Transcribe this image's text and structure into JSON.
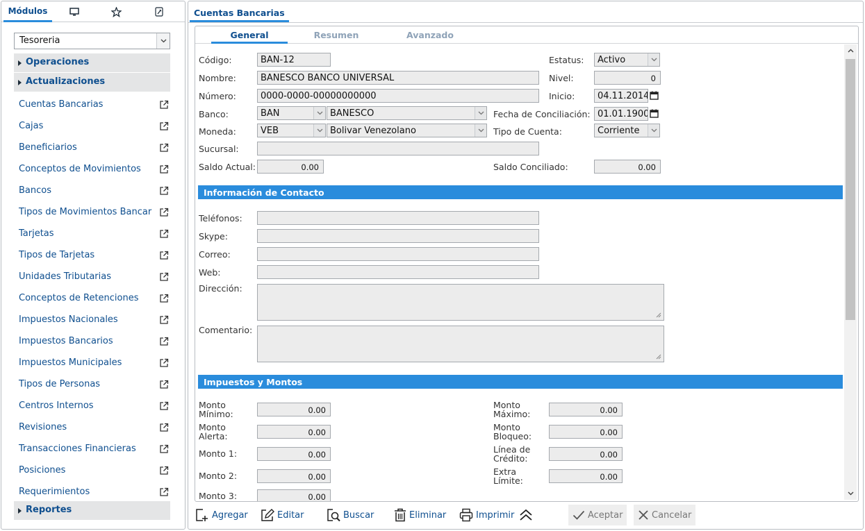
{
  "left": {
    "tabs": {
      "modulos": "Módulos"
    },
    "module_select": "Tesoreria",
    "groups": {
      "operaciones": "Operaciones",
      "actualizaciones": "Actualizaciones",
      "reportes": "Reportes"
    },
    "items": [
      "Cuentas Bancarias",
      "Cajas",
      "Beneficiarios",
      "Conceptos de Movimientos",
      "Bancos",
      "Tipos de Movimientos Bancar",
      "Tarjetas",
      "Tipos de Tarjetas",
      "Unidades Tributarias",
      "Conceptos de Retenciones",
      "Impuestos Nacionales",
      "Impuestos Bancarios",
      "Impuestos Municipales",
      "Tipos de Personas",
      "Centros Internos",
      "Revisiones",
      "Transacciones Financieras",
      "Posiciones",
      "Requerimientos"
    ]
  },
  "right": {
    "title": "Cuentas Bancarias",
    "subtabs": {
      "general": "General",
      "resumen": "Resumen",
      "avanzado": "Avanzado"
    },
    "labels": {
      "codigo": "Código:",
      "nombre": "Nombre:",
      "numero": "Número:",
      "banco": "Banco:",
      "moneda": "Moneda:",
      "sucursal": "Sucursal:",
      "saldo_actual": "Saldo Actual:",
      "estatus": "Estatus:",
      "nivel": "Nivel:",
      "inicio": "Inicio:",
      "fecha_conciliacion": "Fecha de Conciliación:",
      "tipo_cuenta": "Tipo de Cuenta:",
      "saldo_conciliado": "Saldo Conciliado:",
      "telefonos": "Teléfonos:",
      "skype": "Skype:",
      "correo": "Correo:",
      "web": "Web:",
      "direccion": "Dirección:",
      "comentario": "Comentario:",
      "monto_minimo_1": "Monto",
      "monto_minimo_2": "Mínimo:",
      "monto_maximo_1": "Monto",
      "monto_maximo_2": "Máximo:",
      "monto_alerta_1": "Monto",
      "monto_alerta_2": "Alerta:",
      "monto_bloqueo_1": "Monto",
      "monto_bloqueo_2": "Bloqueo:",
      "monto_1": "Monto 1:",
      "linea_credito_1": "Línea de",
      "linea_credito_2": "Crédito:",
      "monto_2": "Monto 2:",
      "extra_limite_1": "Extra",
      "extra_limite_2": "Límite:",
      "monto_3": "Monto 3:"
    },
    "values": {
      "codigo": "BAN-12",
      "nombre": "BANESCO BANCO UNIVERSAL",
      "numero": "0000-0000-00000000000",
      "banco_code": "BAN",
      "banco_name": "BANESCO",
      "moneda_code": "VEB",
      "moneda_name": "Bolivar Venezolano",
      "saldo_actual": "0.00",
      "estatus": "Activo",
      "nivel": "0",
      "inicio": "04.11.2014",
      "fecha_conciliacion": "01.01.1900",
      "tipo_cuenta": "Corriente",
      "saldo_conciliado": "0.00",
      "monto_minimo": "0.00",
      "monto_maximo": "0.00",
      "monto_alerta": "0.00",
      "monto_bloqueo": "0.00",
      "monto_1": "0.00",
      "linea_credito": "0.00",
      "monto_2": "0.00",
      "extra_limite": "0.00",
      "monto_3": "0.00"
    },
    "sections": {
      "contacto": "Información de Contacto",
      "impuestos": "Impuestos y Montos"
    }
  },
  "toolbar": {
    "agregar": "Agregar",
    "editar": "Editar",
    "buscar": "Buscar",
    "eliminar": "Eliminar",
    "imprimir": "Imprimir",
    "aceptar": "Aceptar",
    "cancelar": "Cancelar"
  },
  "icons": [
    "monitor-icon",
    "star-icon",
    "wrench-icon",
    "external-link-icon",
    "calendar-icon",
    "chevron-down-icon",
    "add-icon",
    "edit-icon",
    "search-icon",
    "trash-icon",
    "print-icon",
    "collapse-icon",
    "check-icon",
    "close-icon"
  ],
  "colors": {
    "accent": "#2a8cdc",
    "link": "#0f4f8f"
  }
}
